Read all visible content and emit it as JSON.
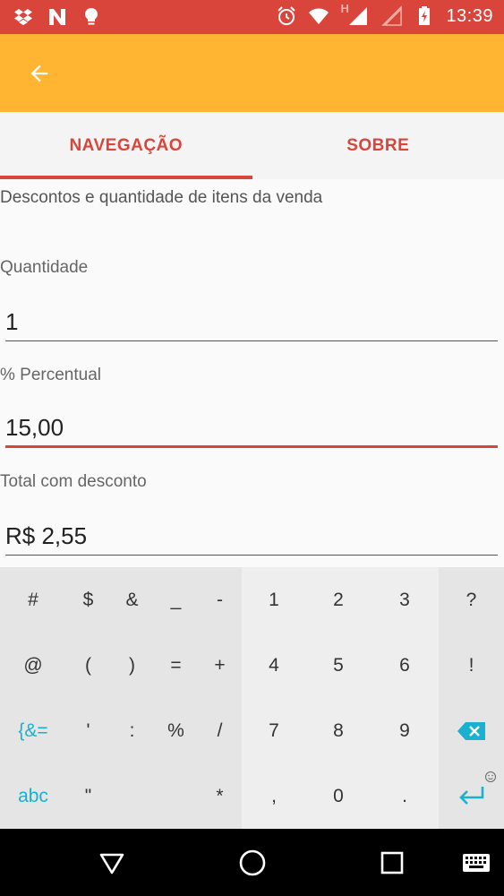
{
  "status_bar": {
    "time": "13:39",
    "network_label": "H",
    "left_icons": [
      "dropbox-icon",
      "n-notification-icon",
      "lightbulb-icon"
    ],
    "right_icons": [
      "alarm-icon",
      "wifi-icon",
      "signal-icon",
      "signal-empty-icon",
      "battery-charging-icon"
    ]
  },
  "app_bar": {
    "color": "#ffb531",
    "back_icon": "arrow-back-icon"
  },
  "tabs": [
    {
      "label": "NAVEGAÇÃO",
      "active": true
    },
    {
      "label": "SOBRE",
      "active": false
    }
  ],
  "form": {
    "description": "Descontos e quantidade de itens da venda",
    "quantity": {
      "label": "Quantidade",
      "value": "1"
    },
    "percent": {
      "label": "% Percentual",
      "value": "15,00"
    },
    "total": {
      "label": "Total com desconto",
      "value": "R$ 2,55"
    }
  },
  "keyboard": {
    "rows": [
      [
        "#",
        "$",
        "&",
        "_",
        "-",
        "1",
        "2",
        "3",
        "?"
      ],
      [
        "@",
        "(",
        ")",
        "=",
        "+",
        "4",
        "5",
        "6",
        "!"
      ],
      [
        "{&=",
        "'",
        ":",
        "%",
        "/",
        "7",
        "8",
        "9",
        "backspace-icon"
      ],
      [
        "abc",
        "\"",
        "",
        "*",
        ",",
        "0",
        ".",
        "enter-icon"
      ]
    ]
  },
  "colors": {
    "status_bar": "#d9453b",
    "accent": "#d9453b",
    "keyboard_accent": "#1ab1d1"
  },
  "nav_bar": {
    "icons": [
      "back-triangle-icon",
      "home-circle-icon",
      "recents-square-icon",
      "keyboard-icon"
    ]
  }
}
